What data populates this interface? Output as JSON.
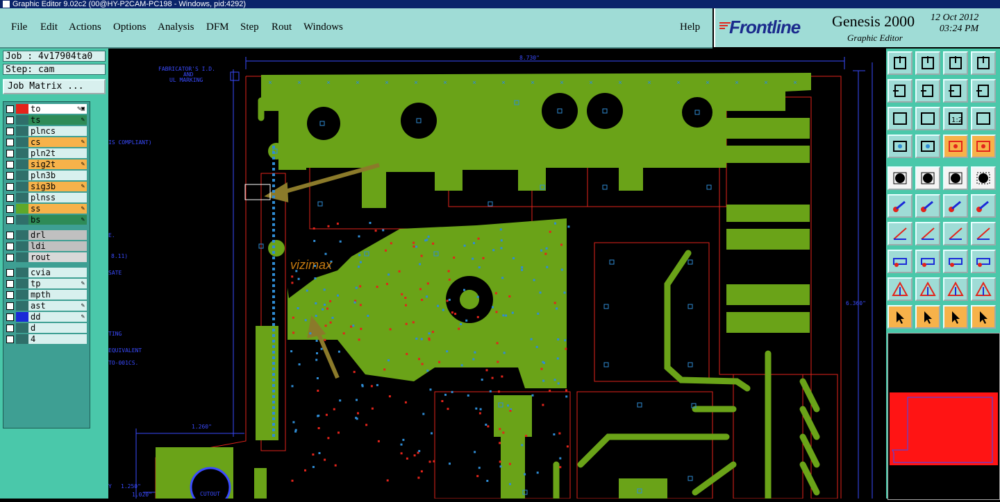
{
  "window": {
    "title": "Graphic Editor 9.02c2 (00@HY-P2CAM-PC198 - Windows, pid:4292)"
  },
  "menu": {
    "items": [
      "File",
      "Edit",
      "Actions",
      "Options",
      "Analysis",
      "DFM",
      "Step",
      "Rout",
      "Windows"
    ],
    "help": "Help"
  },
  "brand": {
    "logo": "Frontline",
    "product": "Genesis 2000",
    "subtitle": "Graphic Editor",
    "date": "12 Oct 2012",
    "time": "03:24 PM"
  },
  "job": {
    "job_label": "Job : 4v17904ta0",
    "step_label": "Step: cam",
    "matrix_button": "Job Matrix ..."
  },
  "layers": [
    {
      "name": "to",
      "color": "#ffffff",
      "swatch": "#e3241b",
      "marker": "✎▣"
    },
    {
      "name": "ts",
      "color": "#2e8b57",
      "swatch": "#2f6f6a",
      "marker": "✎"
    },
    {
      "name": "plncs",
      "color": "#d8f0ee",
      "swatch": "#2f6f6a",
      "marker": ""
    },
    {
      "name": "cs",
      "color": "#f7b24a",
      "swatch": "#2f6f6a",
      "marker": "✎"
    },
    {
      "name": "pln2t",
      "color": "#d8f0ee",
      "swatch": "#2f6f6a",
      "marker": ""
    },
    {
      "name": "sig2t",
      "color": "#f7b24a",
      "swatch": "#2f6f6a",
      "marker": "✎"
    },
    {
      "name": "pln3b",
      "color": "#d8f0ee",
      "swatch": "#2f6f6a",
      "marker": ""
    },
    {
      "name": "sig3b",
      "color": "#f7b24a",
      "swatch": "#2f6f6a",
      "marker": "✎"
    },
    {
      "name": "plnss",
      "color": "#d8f0ee",
      "swatch": "#2f6f6a",
      "marker": ""
    },
    {
      "name": "ss",
      "color": "#f7b24a",
      "swatch": "#5ea82a",
      "marker": "✎"
    },
    {
      "name": "bs",
      "color": "#2e8b57",
      "swatch": "#2f6f6a",
      "marker": "✎"
    },
    {
      "name": "drl",
      "color": "#c0c0c0",
      "swatch": "#2f6f6a",
      "marker": ""
    },
    {
      "name": "ldi",
      "color": "#c0c0c0",
      "swatch": "#2f6f6a",
      "marker": ""
    },
    {
      "name": "rout",
      "color": "#d8d8d8",
      "swatch": "#2f6f6a",
      "marker": ""
    },
    {
      "name": "cvia",
      "color": "#d8f0ee",
      "swatch": "#2f6f6a",
      "marker": ""
    },
    {
      "name": "tp",
      "color": "#d8f0ee",
      "swatch": "#2f6f6a",
      "marker": "✎"
    },
    {
      "name": "mpth",
      "color": "#d8f0ee",
      "swatch": "#2f6f6a",
      "marker": ""
    },
    {
      "name": "ast",
      "color": "#d8f0ee",
      "swatch": "#2f6f6a",
      "marker": "✎"
    },
    {
      "name": "dd",
      "color": "#d8f0ee",
      "swatch": "#1a2ad8",
      "marker": "✎"
    },
    {
      "name": "d",
      "color": "#d8f0ee",
      "swatch": "#2f6f6a",
      "marker": ""
    },
    {
      "name": "4",
      "color": "#d8f0ee",
      "swatch": "#2f6f6a",
      "marker": ""
    }
  ],
  "canvas": {
    "dim_top": "8.730\"",
    "dim_right": "6.360\"",
    "dim_left": "1.260\"",
    "dim_bl1": "1.250\"",
    "dim_bl2": "1.020\"",
    "fab_note": "FABRICATOR'S I.D.",
    "fab_and": "AND",
    "fab_ul": "UL MARKING",
    "compliant": "IS COMPLIANT)",
    "side_e": "E.",
    "side_811": "8.11)",
    "side_sate": "SATE",
    "side_ting": "TING",
    "side_equivalent": "EQUIVALENT",
    "side_to": "TO-001CS.",
    "cutout": "CUTOUT",
    "vizimax": "vizimax",
    "cursor_note": "Y",
    "colors": {
      "copper": "#6aa318",
      "outline": "#e3241b",
      "dim": "#3a4bff",
      "pad": "#2f8cd4",
      "silk": "#c77b10"
    }
  },
  "toolbox": {
    "icons": [
      "layer-up-icon",
      "layer-down-icon",
      "home-icon",
      "window-icon",
      "move-left-icon",
      "move-right-icon",
      "mirror-icon",
      "s-curve-icon",
      "fit-icon",
      "zoom-center-icon",
      "ratio-1-2-icon",
      "help-icon",
      "feature-icon",
      "grid-icon",
      "layer-compare-icon",
      "layer-compare2-icon",
      "add-pad-icon",
      "route-line-icon",
      "ruler-icon",
      "select-pad-icon",
      "snap-icon",
      "cross-icon",
      "connect-icon",
      "connect2-icon",
      "angle-icon",
      "slash-icon",
      "rotate-icon",
      "flip-icon",
      "pad-move-icon",
      "minus-icon",
      "measure-icon",
      "group-icon",
      "triangle-icon",
      "triangle-up-icon",
      "a-icon",
      "a2-icon",
      "pointer-icon",
      "pointer-frame-icon",
      "pointer-box-icon",
      "net-icon"
    ]
  }
}
